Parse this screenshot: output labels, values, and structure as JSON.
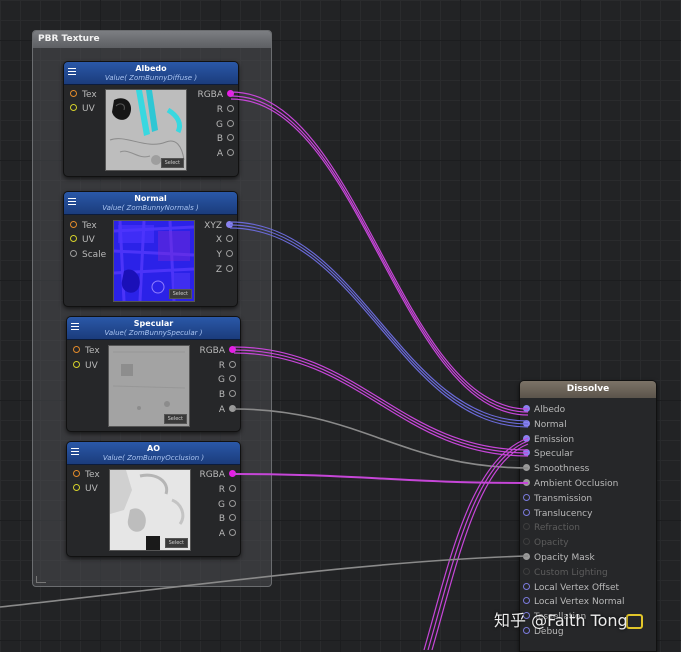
{
  "group": {
    "title": "PBR Texture"
  },
  "colors": {
    "purple_port": "#8a83f0",
    "magenta_port": "#e61ee6",
    "grey_port": "#9a9a9a",
    "tex_port": "#e28a2a",
    "uv_port": "#d5d12a"
  },
  "nodes": [
    {
      "title": "Albedo",
      "subtitle": "Value( ZomBunnyDiffuse )",
      "inputs": [
        "Tex",
        "UV"
      ],
      "outputs": [
        "RGBA",
        "R",
        "G",
        "B",
        "A"
      ],
      "select_label": "Select"
    },
    {
      "title": "Normal",
      "subtitle": "Value( ZomBunnyNormals )",
      "inputs": [
        "Tex",
        "UV",
        "Scale"
      ],
      "outputs": [
        "XYZ",
        "X",
        "Y",
        "Z"
      ],
      "select_label": "Select"
    },
    {
      "title": "Specular",
      "subtitle": "Value( ZomBunnySpecular )",
      "inputs": [
        "Tex",
        "UV"
      ],
      "outputs": [
        "RGBA",
        "R",
        "G",
        "B",
        "A"
      ],
      "select_label": "Select"
    },
    {
      "title": "AO",
      "subtitle": "Value( ZomBunnyOcclusion )",
      "inputs": [
        "Tex",
        "UV"
      ],
      "outputs": [
        "RGBA",
        "R",
        "G",
        "B",
        "A"
      ],
      "select_label": "Select"
    }
  ],
  "dissolve": {
    "title": "Dissolve",
    "ports": [
      {
        "label": "Albedo",
        "enabled": true
      },
      {
        "label": "Normal",
        "enabled": true
      },
      {
        "label": "Emission",
        "enabled": true
      },
      {
        "label": "Specular",
        "enabled": true
      },
      {
        "label": "Smoothness",
        "enabled": true
      },
      {
        "label": "Ambient Occlusion",
        "enabled": true
      },
      {
        "label": "Transmission",
        "enabled": true
      },
      {
        "label": "Translucency",
        "enabled": true
      },
      {
        "label": "Refraction",
        "enabled": false
      },
      {
        "label": "Opacity",
        "enabled": false
      },
      {
        "label": "Opacity Mask",
        "enabled": true
      },
      {
        "label": "Custom Lighting",
        "enabled": false
      },
      {
        "label": "Local Vertex Offset",
        "enabled": true
      },
      {
        "label": "Local Vertex Normal",
        "enabled": true
      },
      {
        "label": "Tessellation",
        "enabled": true
      },
      {
        "label": "Debug",
        "enabled": true
      }
    ]
  },
  "watermark": "知乎 @Faith Tong"
}
